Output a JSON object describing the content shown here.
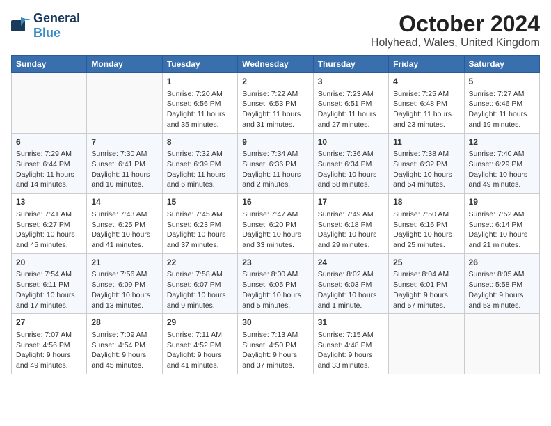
{
  "header": {
    "logo_line1": "General",
    "logo_line2": "Blue",
    "month": "October 2024",
    "location": "Holyhead, Wales, United Kingdom"
  },
  "weekdays": [
    "Sunday",
    "Monday",
    "Tuesday",
    "Wednesday",
    "Thursday",
    "Friday",
    "Saturday"
  ],
  "weeks": [
    [
      {
        "day": "",
        "content": ""
      },
      {
        "day": "",
        "content": ""
      },
      {
        "day": "1",
        "content": "Sunrise: 7:20 AM\nSunset: 6:56 PM\nDaylight: 11 hours and 35 minutes."
      },
      {
        "day": "2",
        "content": "Sunrise: 7:22 AM\nSunset: 6:53 PM\nDaylight: 11 hours and 31 minutes."
      },
      {
        "day": "3",
        "content": "Sunrise: 7:23 AM\nSunset: 6:51 PM\nDaylight: 11 hours and 27 minutes."
      },
      {
        "day": "4",
        "content": "Sunrise: 7:25 AM\nSunset: 6:48 PM\nDaylight: 11 hours and 23 minutes."
      },
      {
        "day": "5",
        "content": "Sunrise: 7:27 AM\nSunset: 6:46 PM\nDaylight: 11 hours and 19 minutes."
      }
    ],
    [
      {
        "day": "6",
        "content": "Sunrise: 7:29 AM\nSunset: 6:44 PM\nDaylight: 11 hours and 14 minutes."
      },
      {
        "day": "7",
        "content": "Sunrise: 7:30 AM\nSunset: 6:41 PM\nDaylight: 11 hours and 10 minutes."
      },
      {
        "day": "8",
        "content": "Sunrise: 7:32 AM\nSunset: 6:39 PM\nDaylight: 11 hours and 6 minutes."
      },
      {
        "day": "9",
        "content": "Sunrise: 7:34 AM\nSunset: 6:36 PM\nDaylight: 11 hours and 2 minutes."
      },
      {
        "day": "10",
        "content": "Sunrise: 7:36 AM\nSunset: 6:34 PM\nDaylight: 10 hours and 58 minutes."
      },
      {
        "day": "11",
        "content": "Sunrise: 7:38 AM\nSunset: 6:32 PM\nDaylight: 10 hours and 54 minutes."
      },
      {
        "day": "12",
        "content": "Sunrise: 7:40 AM\nSunset: 6:29 PM\nDaylight: 10 hours and 49 minutes."
      }
    ],
    [
      {
        "day": "13",
        "content": "Sunrise: 7:41 AM\nSunset: 6:27 PM\nDaylight: 10 hours and 45 minutes."
      },
      {
        "day": "14",
        "content": "Sunrise: 7:43 AM\nSunset: 6:25 PM\nDaylight: 10 hours and 41 minutes."
      },
      {
        "day": "15",
        "content": "Sunrise: 7:45 AM\nSunset: 6:23 PM\nDaylight: 10 hours and 37 minutes."
      },
      {
        "day": "16",
        "content": "Sunrise: 7:47 AM\nSunset: 6:20 PM\nDaylight: 10 hours and 33 minutes."
      },
      {
        "day": "17",
        "content": "Sunrise: 7:49 AM\nSunset: 6:18 PM\nDaylight: 10 hours and 29 minutes."
      },
      {
        "day": "18",
        "content": "Sunrise: 7:50 AM\nSunset: 6:16 PM\nDaylight: 10 hours and 25 minutes."
      },
      {
        "day": "19",
        "content": "Sunrise: 7:52 AM\nSunset: 6:14 PM\nDaylight: 10 hours and 21 minutes."
      }
    ],
    [
      {
        "day": "20",
        "content": "Sunrise: 7:54 AM\nSunset: 6:11 PM\nDaylight: 10 hours and 17 minutes."
      },
      {
        "day": "21",
        "content": "Sunrise: 7:56 AM\nSunset: 6:09 PM\nDaylight: 10 hours and 13 minutes."
      },
      {
        "day": "22",
        "content": "Sunrise: 7:58 AM\nSunset: 6:07 PM\nDaylight: 10 hours and 9 minutes."
      },
      {
        "day": "23",
        "content": "Sunrise: 8:00 AM\nSunset: 6:05 PM\nDaylight: 10 hours and 5 minutes."
      },
      {
        "day": "24",
        "content": "Sunrise: 8:02 AM\nSunset: 6:03 PM\nDaylight: 10 hours and 1 minute."
      },
      {
        "day": "25",
        "content": "Sunrise: 8:04 AM\nSunset: 6:01 PM\nDaylight: 9 hours and 57 minutes."
      },
      {
        "day": "26",
        "content": "Sunrise: 8:05 AM\nSunset: 5:58 PM\nDaylight: 9 hours and 53 minutes."
      }
    ],
    [
      {
        "day": "27",
        "content": "Sunrise: 7:07 AM\nSunset: 4:56 PM\nDaylight: 9 hours and 49 minutes."
      },
      {
        "day": "28",
        "content": "Sunrise: 7:09 AM\nSunset: 4:54 PM\nDaylight: 9 hours and 45 minutes."
      },
      {
        "day": "29",
        "content": "Sunrise: 7:11 AM\nSunset: 4:52 PM\nDaylight: 9 hours and 41 minutes."
      },
      {
        "day": "30",
        "content": "Sunrise: 7:13 AM\nSunset: 4:50 PM\nDaylight: 9 hours and 37 minutes."
      },
      {
        "day": "31",
        "content": "Sunrise: 7:15 AM\nSunset: 4:48 PM\nDaylight: 9 hours and 33 minutes."
      },
      {
        "day": "",
        "content": ""
      },
      {
        "day": "",
        "content": ""
      }
    ]
  ]
}
